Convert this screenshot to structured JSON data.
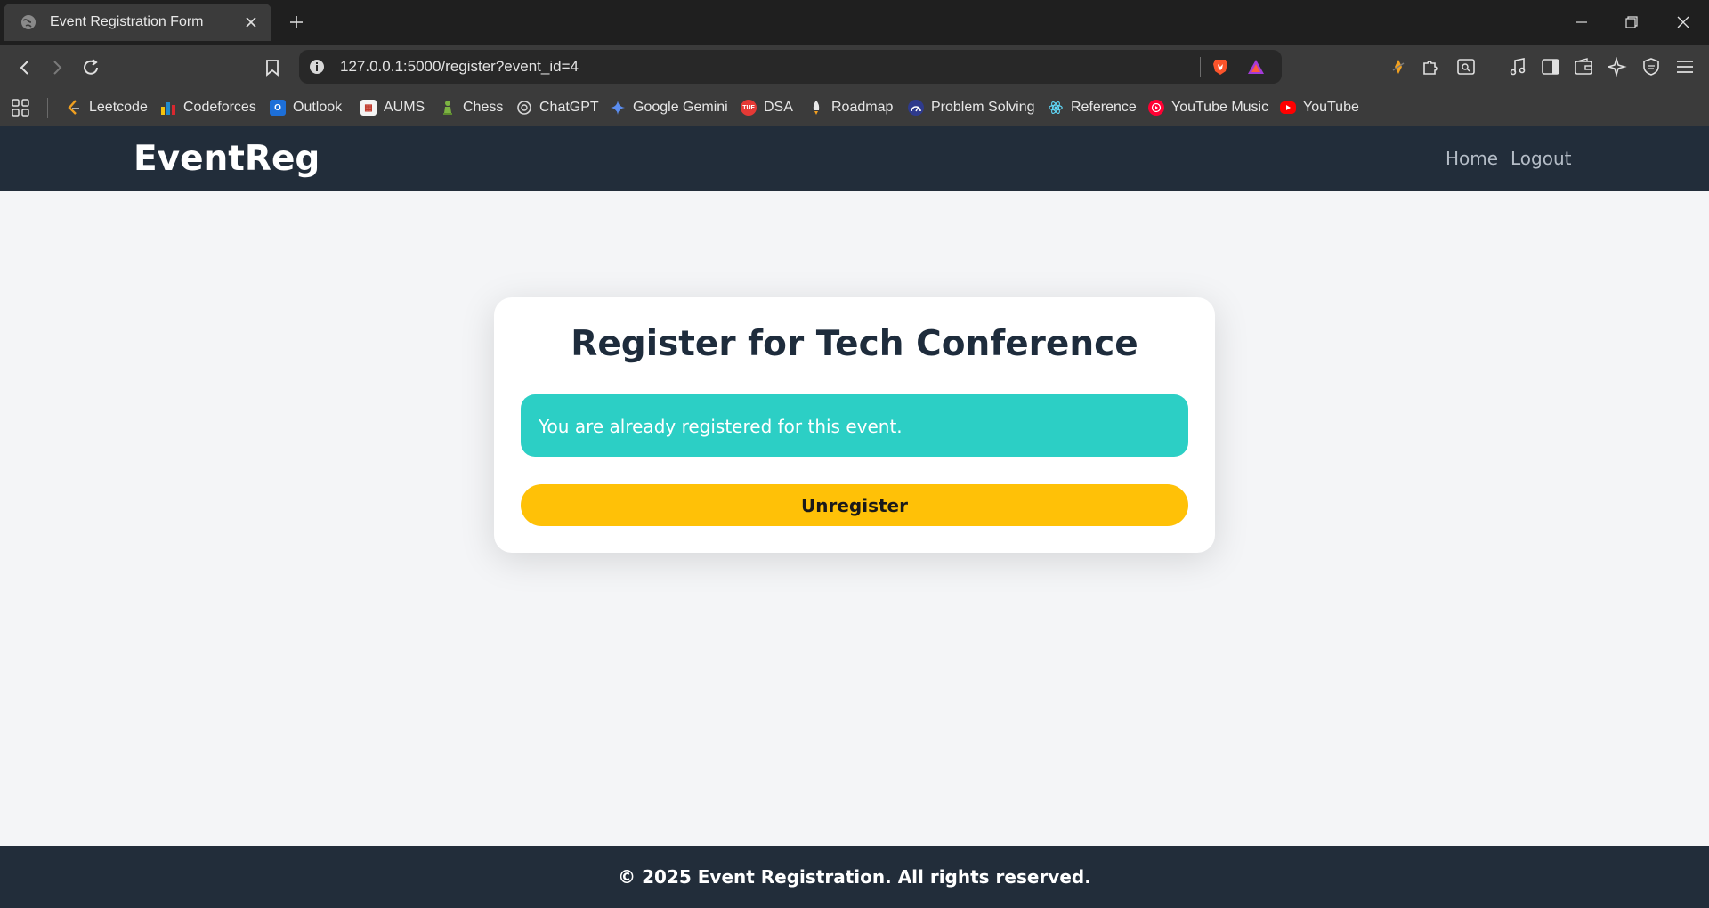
{
  "browser": {
    "tab_title": "Event Registration Form",
    "url": "127.0.0.1:5000/register?event_id=4",
    "bookmarks": [
      {
        "label": "Leetcode",
        "icon": "leetcode-icon",
        "color": "#f0a020"
      },
      {
        "label": "Codeforces",
        "icon": "codeforces-icon",
        "color": "#e8c020"
      },
      {
        "label": "Outlook",
        "icon": "outlook-icon",
        "color": "#1d6fd8"
      },
      {
        "label": "AUMS",
        "icon": "aums-icon",
        "color": "#c0392b"
      },
      {
        "label": "Chess",
        "icon": "chess-icon",
        "color": "#7cb342"
      },
      {
        "label": "ChatGPT",
        "icon": "chatgpt-icon",
        "color": "#d0d0d0"
      },
      {
        "label": "Google Gemini",
        "icon": "gemini-icon",
        "color": "#5b8def"
      },
      {
        "label": "DSA",
        "icon": "dsa-icon",
        "color": "#e53935"
      },
      {
        "label": "Roadmap",
        "icon": "rocket-icon",
        "color": "#f4d03f"
      },
      {
        "label": "Problem Solving",
        "icon": "problem-solving-icon",
        "color": "#3f51b5"
      },
      {
        "label": "Reference",
        "icon": "react-icon",
        "color": "#61dafb"
      },
      {
        "label": "YouTube Music",
        "icon": "youtube-music-icon",
        "color": "#ff0033"
      },
      {
        "label": "YouTube",
        "icon": "youtube-icon",
        "color": "#ff0000"
      }
    ]
  },
  "site": {
    "brand": "EventReg",
    "nav": {
      "home": "Home",
      "logout": "Logout"
    },
    "card": {
      "title": "Register for Tech Conference",
      "alert": "You are already registered for this event.",
      "button": "Unregister"
    },
    "footer": "© 2025 Event Registration. All rights reserved.",
    "colors": {
      "navbar": "#222d3a",
      "alert": "#2ccfc5",
      "button": "#ffc107",
      "background": "#f4f5f7"
    }
  }
}
